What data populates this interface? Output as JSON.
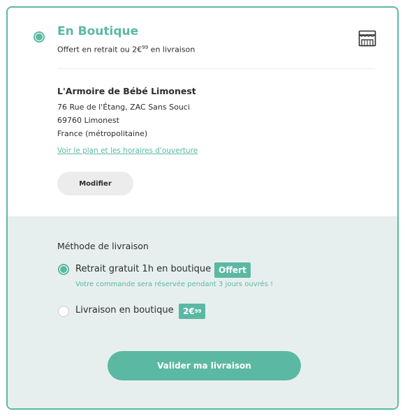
{
  "delivery_option": {
    "title": "En Boutique",
    "subtitle_prefix": "Offert en retrait ou 2€",
    "subtitle_sup": "99",
    "subtitle_suffix": " en livraison",
    "icon": "store-icon"
  },
  "store": {
    "name": "L'Armoire de Bébé Limonest",
    "address_line1": "76 Rue de l'Étang, ZAC Sans Souci",
    "address_line2": "69760 Limonest",
    "address_line3": "France (métropolitaine)",
    "map_link": "Voir le plan et les horaires d'ouverture",
    "modify_label": "Modifier"
  },
  "method": {
    "title": "Méthode de livraison",
    "options": [
      {
        "label": "Retrait gratuit 1h en boutique",
        "badge": "Offert",
        "note": "Votre commande sera réservée pendant 3 jours ouvrés !",
        "selected": true
      },
      {
        "label": "Livraison en boutique",
        "badge_main": "2€",
        "badge_sup": "99",
        "selected": false
      }
    ],
    "submit_label": "Valider ma livraison"
  },
  "colors": {
    "accent": "#5bb8a3",
    "panel_bg": "#e7efee",
    "button_grey": "#ececec"
  }
}
